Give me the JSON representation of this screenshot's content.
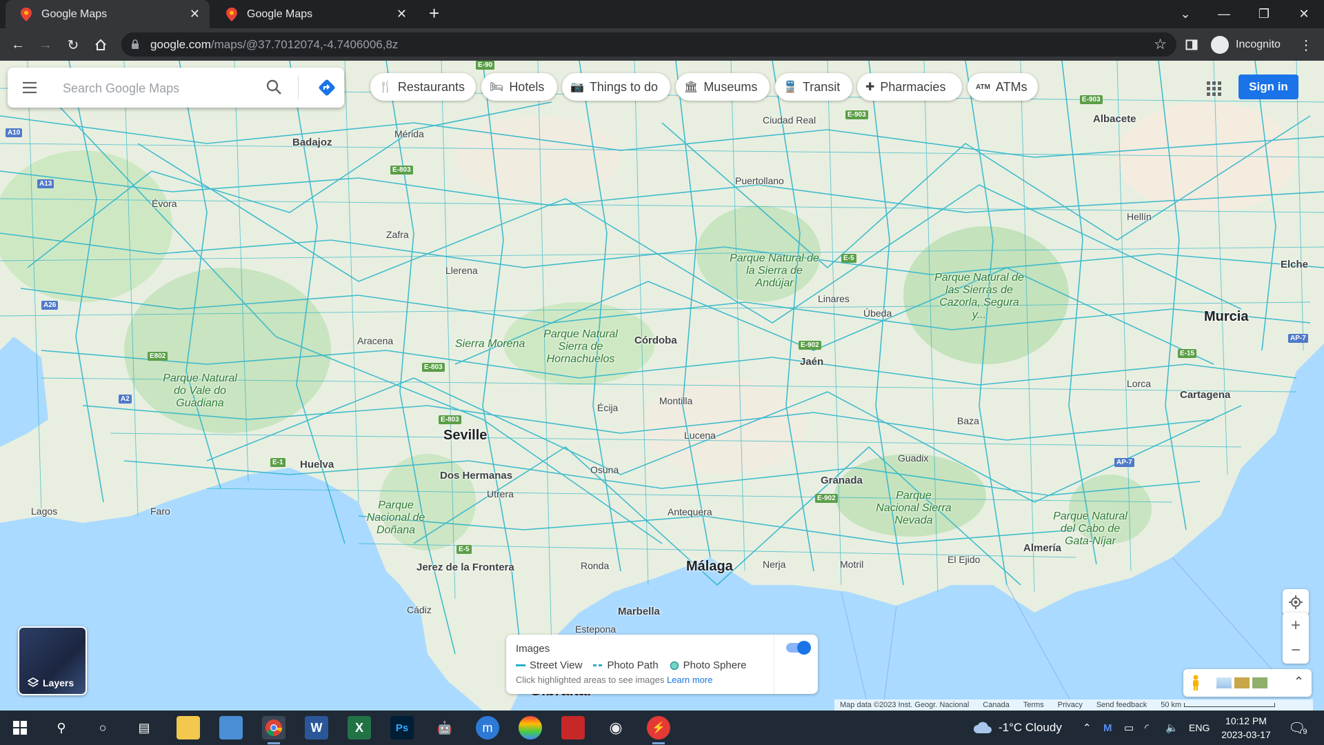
{
  "browser": {
    "tabs": [
      {
        "title": "Google Maps",
        "active": true
      },
      {
        "title": "Google Maps",
        "active": false
      }
    ],
    "url_host": "google.com",
    "url_path": "/maps/@37.7012074,-4.7406006,8z",
    "profile_label": "Incognito"
  },
  "search": {
    "placeholder": "Search Google Maps"
  },
  "chips": [
    {
      "label": "Restaurants",
      "icon": "fork-knife-icon"
    },
    {
      "label": "Hotels",
      "icon": "bed-icon"
    },
    {
      "label": "Things to do",
      "icon": "camera-icon"
    },
    {
      "label": "Museums",
      "icon": "museum-icon"
    },
    {
      "label": "Transit",
      "icon": "train-icon"
    },
    {
      "label": "Pharmacies",
      "icon": "pharmacy-icon"
    },
    {
      "label": "ATMs",
      "icon": "atm-icon"
    }
  ],
  "signin_label": "Sign in",
  "layers_label": "Layers",
  "images_panel": {
    "title": "Images",
    "street_view": "Street View",
    "photo_path": "Photo Path",
    "photo_sphere": "Photo Sphere",
    "hint": "Click highlighted areas to see images",
    "learn_more": "Learn more",
    "toggle_on": true
  },
  "attribution": {
    "map_data": "Map data ©2023 Inst. Geogr. Nacional",
    "country": "Canada",
    "terms": "Terms",
    "privacy": "Privacy",
    "feedback": "Send feedback",
    "scale": "50 km"
  },
  "places": {
    "seville": "Seville",
    "malaga": "Málaga",
    "murcia": "Murcia",
    "cordoba": "Córdoba",
    "granada": "Granada",
    "jaen": "Jaén",
    "almeria": "Almería",
    "cadiz": "Cádiz",
    "huelva": "Huelva",
    "badajoz": "Badajoz",
    "albacete": "Albacete",
    "cartagena": "Cartagena",
    "elche": "Elche",
    "marbella": "Marbella",
    "jerez": "Jerez de la Frontera",
    "dos_hermanas": "Dos Hermanas",
    "ronda": "Ronda",
    "lucena": "Lucena",
    "baza": "Baza",
    "evora": "Évora",
    "lagos": "Lagos",
    "faro": "Faro",
    "ciudad_real": "Ciudad Real",
    "puertollano": "Puertollano",
    "linares": "Linares",
    "ubeda": "Úbeda",
    "hellin": "Hellín",
    "lorca": "Lorca",
    "motril": "Motril",
    "el_ejido": "El Ejido",
    "antequera": "Antequera",
    "ecija": "Écija",
    "osuna": "Osuna",
    "merida": "Mérida",
    "zafra": "Zafra",
    "llerena": "Llerena",
    "aracena": "Aracena",
    "montilla": "Montilla",
    "guadix": "Guadix",
    "estepona": "Estepona",
    "nerja": "Nerja",
    "utrera": "Utrera",
    "gibraltar": "Gibraltar"
  },
  "parks": {
    "sierra_morena": "Sierra Morena",
    "hornachuelos": "Parque Natural Sierra de Hornachuelos",
    "andujar": "Parque Natural de la Sierra de Andújar",
    "cazorla": "Parque Natural de las Sierras de Cazorla, Segura y...",
    "donana": "Parque Nacional de Doñana",
    "sierra_nevada": "Parque Nacional Sierra Nevada",
    "cabo_gata": "Parque Natural del Cabo de Gata-Níjar",
    "vale_guadiana": "Parque Natural do Vale do Guadiana"
  },
  "taskbar": {
    "weather": "-1°C  Cloudy",
    "lang": "ENG",
    "time": "10:12 PM",
    "date": "2023-03-17",
    "notif_count": "9"
  },
  "colors": {
    "accent": "#1a73e8",
    "road": "#27b1c9",
    "land": "#e9efe2",
    "sea": "#aadaff"
  }
}
